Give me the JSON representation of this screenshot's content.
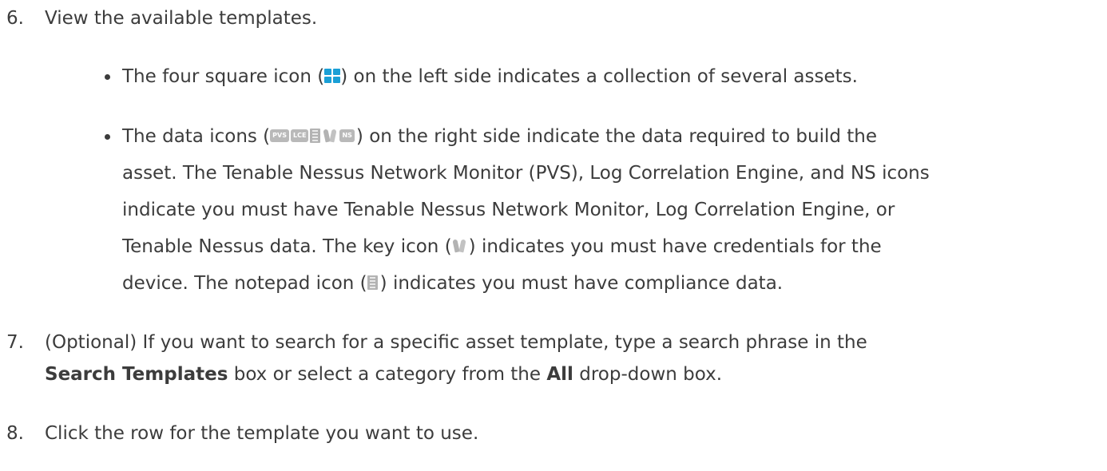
{
  "steps": [
    {
      "number": "6.",
      "text": "View the available templates.",
      "bullets": [
        {
          "lines": [
            {
              "before": "The four square icon (",
              "icon": "four-square-icon",
              "after": ") on the left side indicates a collection of several assets."
            }
          ]
        },
        {
          "lines": [
            {
              "before": "The data icons (",
              "icons": [
                "PVS",
                "LCE",
                "notepad-icon",
                "key-icon",
                "NS"
              ],
              "after": ") on the right side indicate the data required to build the"
            },
            {
              "text": "asset. The Tenable Nessus Network Monitor (PVS), Log Correlation Engine, and NS icons"
            },
            {
              "text": "indicate you must have Tenable Nessus Network Monitor, Log Correlation Engine, or"
            },
            {
              "before": "Tenable Nessus data. The key icon (",
              "icon": "key-icon",
              "after": ") indicates you must have credentials for the"
            },
            {
              "before": "device. The notepad icon (",
              "icon": "notepad-icon",
              "after": ") indicates you must have compliance data."
            }
          ]
        }
      ]
    },
    {
      "number": "7.",
      "line1": "(Optional) If you want to search for a specific asset template, type a search phrase in the",
      "line2_bold1": "Search Templates",
      "line2_mid": " box or select a category from the ",
      "line2_bold2": "All",
      "line2_end": " drop-down box."
    },
    {
      "number": "8.",
      "text": "Click the row for the template you want to use."
    }
  ],
  "colors": {
    "text": "#3c3c3c",
    "grid_icon": "#1a9fd6",
    "data_icon": "#b9b9b9"
  }
}
